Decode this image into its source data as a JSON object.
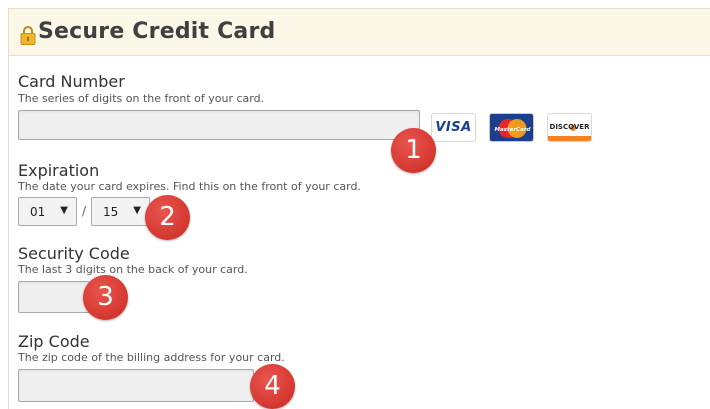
{
  "section": {
    "title": "Secure Credit Card",
    "icon": "lock-icon"
  },
  "card_number": {
    "label": "Card Number",
    "help": "The series of digits on the front of your card.",
    "value": "",
    "accepted_cards": [
      "VISA",
      "MasterCard",
      "DISCOVER"
    ]
  },
  "expiration": {
    "label": "Expiration",
    "help": "The date your card expires. Find this on the front of your card.",
    "month": "01",
    "separator": "/",
    "year": "15"
  },
  "security_code": {
    "label": "Security Code",
    "help": "The last 3 digits on the back of your card.",
    "value": ""
  },
  "zip_code": {
    "label": "Zip Code",
    "help": "The zip code of the billing address for your card.",
    "value": ""
  },
  "markers": [
    "1",
    "2",
    "3",
    "4"
  ],
  "colors": {
    "header_bg": "#fbf8e7",
    "marker": "#d73b33",
    "visa": "#1a3e8f",
    "mastercard_bg": "#1b3f8e",
    "discover_orange": "#f58220"
  }
}
